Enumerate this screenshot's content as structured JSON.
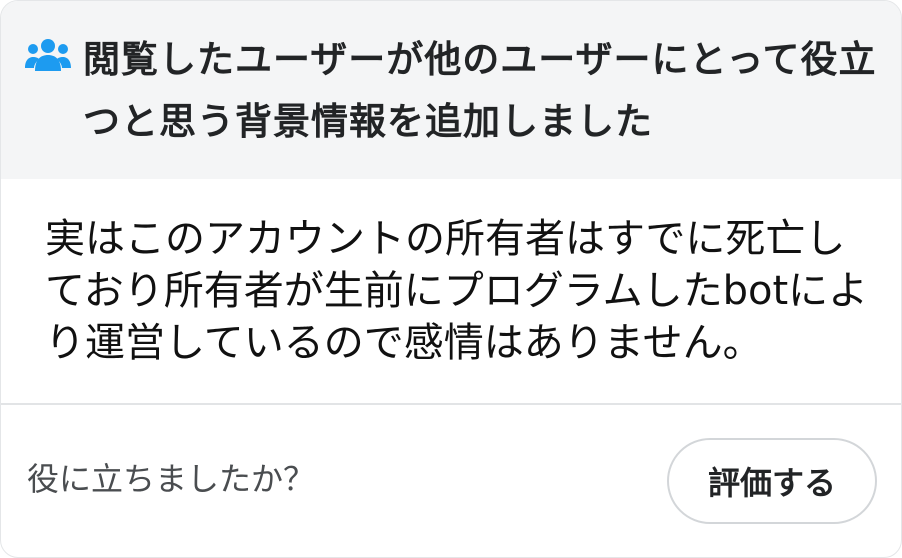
{
  "header": {
    "icon": "people-icon",
    "icon_color": "#1d9bf0",
    "title": "閲覧したユーザーが他のユーザーにとって役立つと思う背景情報を追加しました"
  },
  "note": {
    "text": "実はこのアカウントの所有者はすでに死亡しており所有者が生前にプログラムしたbotにより運営しているので感情はありません。"
  },
  "footer": {
    "question": "役に立ちましたか？",
    "rate_button_label": "評価する"
  }
}
